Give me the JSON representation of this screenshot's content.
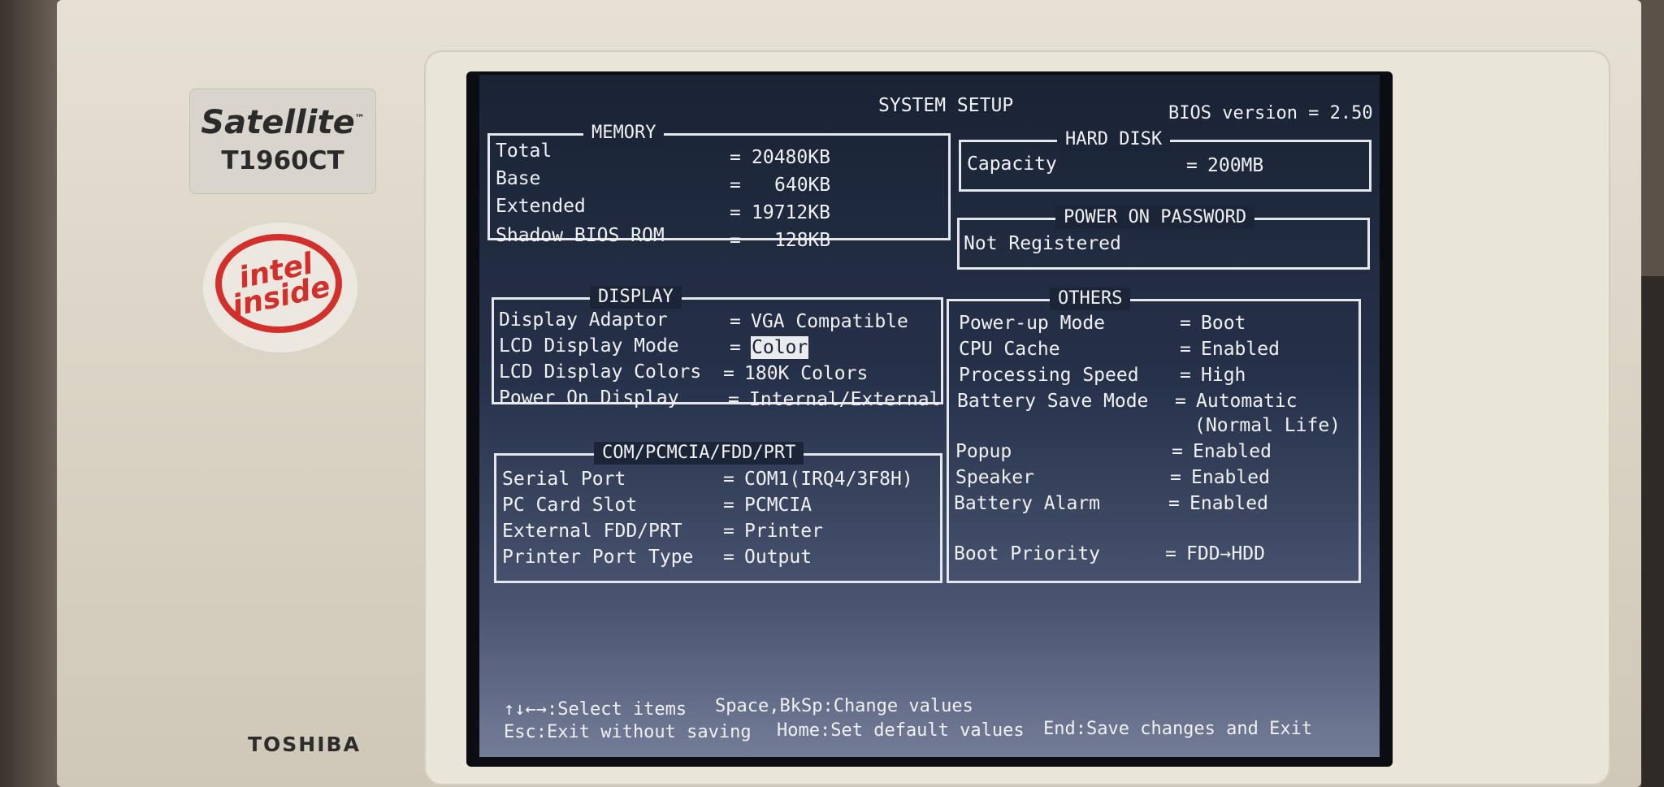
{
  "device": {
    "brand_series": "Satellite",
    "trademark": "™",
    "model": "T1960CT",
    "maker": "TOSHIBA",
    "sticker": "intel inside"
  },
  "bios": {
    "title": "SYSTEM SETUP",
    "version": "BIOS version = 2.50",
    "memory": {
      "title": "MEMORY",
      "rows": [
        {
          "label": "Total",
          "sep": "=",
          "value": "20480KB"
        },
        {
          "label": "Base",
          "sep": "=",
          "value": "640KB"
        },
        {
          "label": "Extended",
          "sep": "=",
          "value": "19712KB"
        },
        {
          "label": "Shadow BIOS ROM",
          "sep": "=",
          "value": "128KB"
        }
      ]
    },
    "hard_disk": {
      "title": "HARD DISK",
      "rows": [
        {
          "label": "Capacity",
          "sep": "=",
          "value": "200MB"
        }
      ]
    },
    "power_on_password": {
      "title": "POWER ON PASSWORD",
      "value": "Not Registered"
    },
    "display": {
      "title": "DISPLAY",
      "rows": [
        {
          "label": "Display Adaptor",
          "sep": "=",
          "value": "VGA Compatible"
        },
        {
          "label": "LCD Display Mode",
          "sep": "=",
          "value": "Color"
        },
        {
          "label": "LCD Display Colors",
          "sep": "=",
          "value": "180K Colors"
        },
        {
          "label": "Power On Display",
          "sep": "=",
          "value": "Internal/External"
        }
      ]
    },
    "ports": {
      "title": "COM/PCMCIA/FDD/PRT",
      "rows": [
        {
          "label": "Serial Port",
          "sep": "=",
          "value": "COM1(IRQ4/3F8H)"
        },
        {
          "label": "PC Card Slot",
          "sep": "=",
          "value": "PCMCIA"
        },
        {
          "label": "External FDD/PRT",
          "sep": "=",
          "value": "Printer"
        },
        {
          "label": "Printer Port Type",
          "sep": "=",
          "value": "Output"
        }
      ]
    },
    "others": {
      "title": "OTHERS",
      "rows": [
        {
          "label": "Power-up Mode",
          "sep": "=",
          "value": "Boot"
        },
        {
          "label": "CPU Cache",
          "sep": "=",
          "value": "Enabled"
        },
        {
          "label": "Processing Speed",
          "sep": "=",
          "value": "High"
        },
        {
          "label": "Battery Save Mode",
          "sep": "=",
          "value": "Automatic"
        },
        {
          "label": "",
          "sep": "",
          "value": "(Normal Life)"
        },
        {
          "label": "Popup",
          "sep": "=",
          "value": "Enabled"
        },
        {
          "label": "Speaker",
          "sep": "=",
          "value": "Enabled"
        },
        {
          "label": "Battery Alarm",
          "sep": "=",
          "value": "Enabled"
        },
        {
          "label": "Boot Priority",
          "sep": "=",
          "value": "FDD→HDD"
        }
      ]
    },
    "footer": {
      "select": "↑↓←→:Select items",
      "change": "Space,BkSp:Change values",
      "exit": "Esc:Exit without saving",
      "defaults": "Home:Set default values",
      "save": "End:Save changes and Exit"
    }
  }
}
